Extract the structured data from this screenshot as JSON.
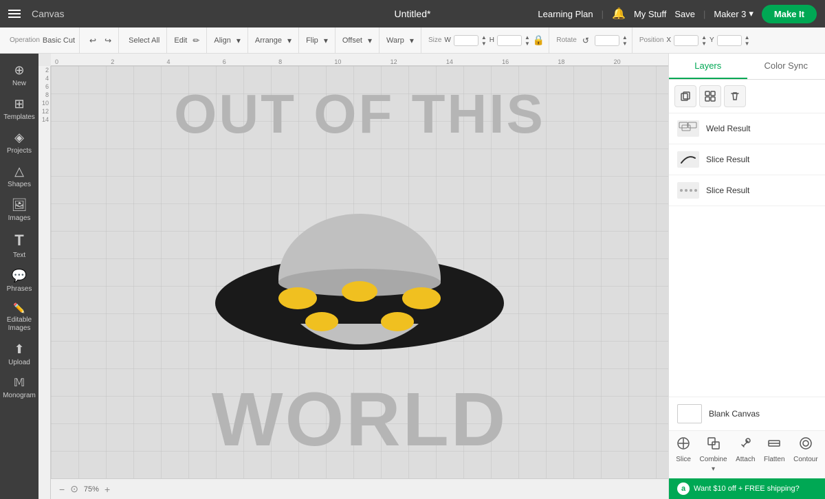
{
  "topnav": {
    "hamburger_label": "Menu",
    "app_name": "Canvas",
    "doc_title": "Untitled*",
    "learning_plan": "Learning Plan",
    "divider1": "|",
    "my_stuff": "My Stuff",
    "save": "Save",
    "divider2": "|",
    "maker": "Maker 3",
    "make_it": "Make It"
  },
  "toolbar": {
    "operation_label": "Operation",
    "operation_value": "Basic Cut",
    "select_all": "Select All",
    "edit": "Edit",
    "align": "Align",
    "arrange": "Arrange",
    "flip": "Flip",
    "offset": "Offset",
    "warp": "Warp",
    "size": "Size",
    "size_w": "W",
    "size_h": "H",
    "rotate": "Rotate",
    "position": "Position",
    "position_x": "X",
    "position_y": "Y"
  },
  "sidebar": {
    "items": [
      {
        "id": "new",
        "icon": "⊕",
        "label": "New"
      },
      {
        "id": "templates",
        "icon": "⊞",
        "label": "Templates"
      },
      {
        "id": "projects",
        "icon": "◈",
        "label": "Projects"
      },
      {
        "id": "shapes",
        "icon": "△",
        "label": "Shapes"
      },
      {
        "id": "images",
        "icon": "🖼",
        "label": "Images"
      },
      {
        "id": "text",
        "icon": "T",
        "label": "Text"
      },
      {
        "id": "phrases",
        "icon": "💬",
        "label": "Phrases"
      },
      {
        "id": "editable-images",
        "icon": "✏",
        "label": "Editable Images"
      },
      {
        "id": "upload",
        "icon": "↑",
        "label": "Upload"
      },
      {
        "id": "monogram",
        "icon": "Ш",
        "label": "Monogram"
      }
    ]
  },
  "design": {
    "text_top": "OUT OF THIS",
    "text_bottom": "WORLD"
  },
  "right_panel": {
    "tab_layers": "Layers",
    "tab_color_sync": "Color Sync",
    "active_tab": "layers",
    "action_duplicate": "⧉",
    "action_group": "⊞",
    "action_delete": "🗑",
    "layers": [
      {
        "id": "weld-result",
        "name": "Weld Result",
        "thumb_type": "grid"
      },
      {
        "id": "slice-result-1",
        "name": "Slice Result",
        "thumb_type": "curve"
      },
      {
        "id": "slice-result-2",
        "name": "Slice Result",
        "thumb_type": "dots"
      }
    ],
    "blank_canvas_label": "Blank Canvas"
  },
  "bottom_actions": [
    {
      "id": "slice",
      "icon": "✂",
      "label": "Slice"
    },
    {
      "id": "combine",
      "icon": "⊕",
      "label": "Combine"
    },
    {
      "id": "attach",
      "icon": "🔗",
      "label": "Attach"
    },
    {
      "id": "flatten",
      "icon": "▣",
      "label": "Flatten"
    },
    {
      "id": "contour",
      "icon": "◎",
      "label": "Contour"
    }
  ],
  "promo": {
    "icon": "a",
    "text": "Want $10 off + FREE shipping?"
  },
  "status": {
    "zoom": "75%",
    "zoom_in": "+",
    "zoom_out": "−"
  },
  "ruler_h": [
    "0",
    "2",
    "4",
    "6",
    "8",
    "10",
    "12",
    "14",
    "16",
    "18",
    "20"
  ],
  "ruler_v": [
    "2",
    "4",
    "6",
    "8",
    "10",
    "12",
    "14"
  ]
}
